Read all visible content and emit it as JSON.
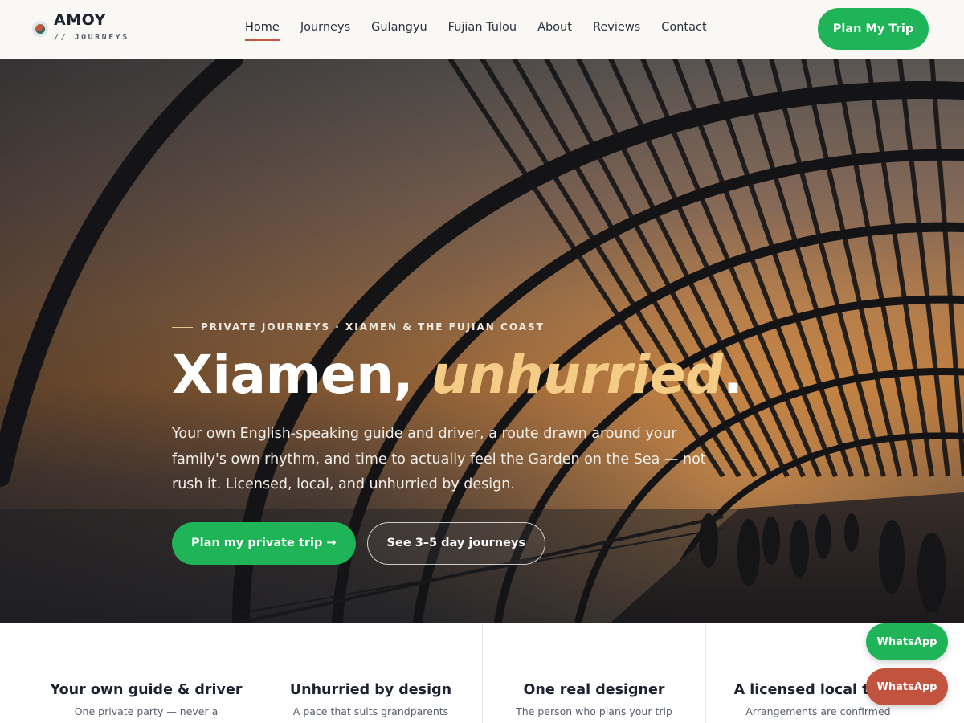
{
  "header": {
    "brand_name": "AMOY",
    "brand_sub": "// JOURNEYS",
    "nav": [
      {
        "label": "Home",
        "active": true
      },
      {
        "label": "Journeys",
        "active": false
      },
      {
        "label": "Gulangyu",
        "active": false
      },
      {
        "label": "Fujian Tulou",
        "active": false
      },
      {
        "label": "About",
        "active": false
      },
      {
        "label": "Reviews",
        "active": false
      },
      {
        "label": "Contact",
        "active": false
      }
    ],
    "cta_label": "Plan My Trip"
  },
  "hero": {
    "eyebrow": "PRIVATE JOURNEYS · XIAMEN & THE FUJIAN COAST",
    "title_main": "Xiamen, ",
    "title_emphasis": "unhurried",
    "title_end": ".",
    "description": "Your own English-speaking guide and driver, a route drawn around your family's own rhythm, and time to actually feel the Garden on the Sea — not rush it. Licensed, local, and unhurried by design.",
    "primary_button": "Plan my private trip →",
    "secondary_button": "See 3–5 day journeys"
  },
  "features": [
    {
      "title": "Your own guide & driver",
      "desc": "One private party — never a"
    },
    {
      "title": "Unhurried by design",
      "desc": "A pace that suits grandparents"
    },
    {
      "title": "One real designer",
      "desc": "The person who plans your trip"
    },
    {
      "title": "A licensed local team",
      "desc": "Arrangements are confirmed"
    }
  ],
  "floating": {
    "whatsapp_primary": "WhatsApp",
    "whatsapp_secondary": "WhatsApp"
  },
  "colors": {
    "accent_green": "#1fb457",
    "accent_red": "#c2533e",
    "title_gold": "#f5cc85"
  }
}
